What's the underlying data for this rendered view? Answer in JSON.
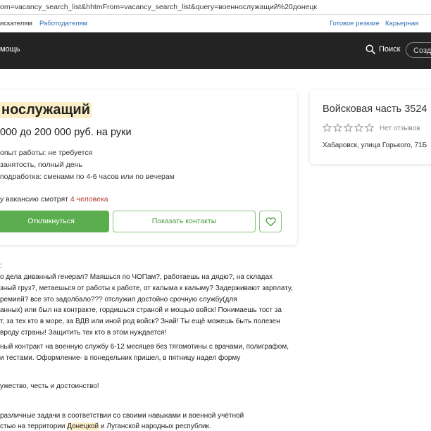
{
  "browser": {
    "url": "om=vacancy_search_list&hhtmFrom=vacancy_search_list&query=военнослужащий%20донецк"
  },
  "topbar": {
    "job_seekers": "искателям",
    "employers": "Работодателям",
    "ready_resume": "Готовое резюме",
    "career_consult": "Карьерная конс"
  },
  "nav": {
    "help": "мощь",
    "search_label": "Поиск",
    "create_label": "Созд"
  },
  "vacancy": {
    "title": "нослужащий",
    "salary": "000 до 200 000 руб. на руки",
    "properties": [
      "опыт работы: не требуется",
      "занятость, полный день",
      "подработка: сменами по 4-6 часов или по вечерам"
    ],
    "viewers_prefix": "у вакансию смотрят ",
    "viewers_count": "4 человека",
    "apply_label": "Откликнуться",
    "contacts_label": "Показать контакты"
  },
  "employer": {
    "name": "Войсковая часть 3524",
    "rating_stars": 0,
    "no_reviews": "Нет отзывов",
    "address": "Хабаровск, улица Горького, 71Б"
  },
  "description": {
    "heading": ":",
    "lines": [
      "о дела диванный генерал? Маяшься по ЧОПам?, работаешь на дядю?, на складах",
      "зный груз?, метаешься от работы к работе, от калыма к калыму? Задерживают зарплату,",
      "ремией? все это задолбало??? отслужил достойно срочную службу(для",
      "анных) или был на контракте, гордишься страной и мощью войск! Понимаешь тост за",
      "т, за тех кто в море, за ВДВ или иной род войск? Знай! Ты ещё можешь быть полезен",
      "вроду страны! Защитить тех кто в этом нуждается!",
      "ный контракт на военную службу 6-12 месяцев без тягомотины с врачами, полиграфом,",
      " и тестами. Оформление- в понедельник пришел, в пятницу надел форму",
      "ужество, честь и достоинство!",
      " различные задачи в соответствии со своими навыками и военной учётной"
    ],
    "last_line_prefix": "стью на территории ",
    "last_line_highlight": "Донецкой",
    "last_line_suffix": " и Луганской народных республик."
  }
}
